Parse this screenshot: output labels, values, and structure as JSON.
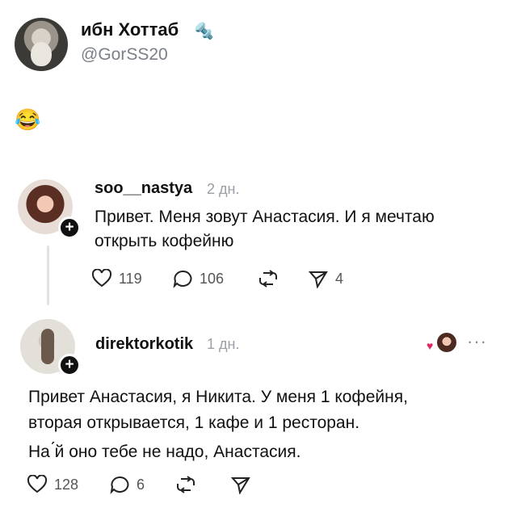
{
  "header": {
    "display_name": "ибн Хоттаб",
    "badge_icon": "bolt-icon",
    "handle": "@GorSS20",
    "post_emoji": "😂"
  },
  "comments": [
    {
      "username": "soo__nastya",
      "time": "2 дн.",
      "text_lines": [
        "Привет. Меня зовут Анастасия. И я мечтаю",
        "открыть кофейню"
      ],
      "likes": "119",
      "replies": "106",
      "shares": "4"
    },
    {
      "username": "direktorkotik",
      "time": "1 дн.",
      "more": "···",
      "text_lines": [
        "Привет Анастасия, я Никита. У меня 1 кофейня,",
        "вторая открывается, 1 кафе и 1 ресторан.",
        "На  ́й оно тебе не надо, Анастасия."
      ],
      "likes": "128",
      "replies": "6"
    }
  ]
}
